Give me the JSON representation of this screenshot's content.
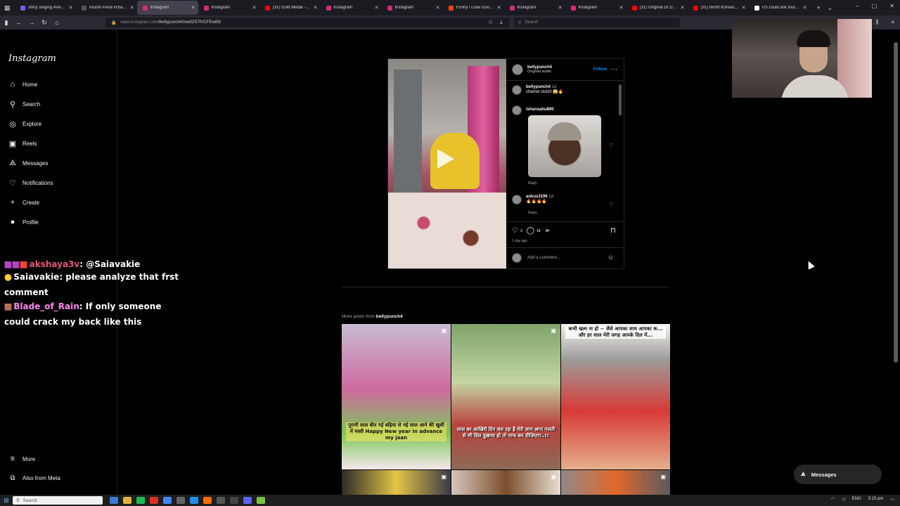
{
  "browser": {
    "tabs": [
      {
        "title": "Jinny singing AVAVA -",
        "color": "#7a5cff"
      },
      {
        "title": "#sushi #viral #challen",
        "color": "#555555"
      },
      {
        "title": "Instagram",
        "color": "#d62976",
        "active": true
      },
      {
        "title": "Instagram",
        "color": "#d62976"
      },
      {
        "title": "(31) Gold Medal - FS",
        "color": "#ff0000"
      },
      {
        "title": "Instagram",
        "color": "#d62976"
      },
      {
        "title": "Instagram",
        "color": "#d62976"
      },
      {
        "title": "Funny I Love Gooning",
        "color": "#ff4500"
      },
      {
        "title": "Instagram",
        "color": "#d62976"
      },
      {
        "title": "Instagram",
        "color": "#d62976"
      },
      {
        "title": "(31) Original Dr Donu",
        "color": "#ff0000"
      },
      {
        "title": "(31) North Koreans W",
        "color": "#ff0000"
      },
      {
        "title": "US could ask tourists",
        "color": "#ffffff"
      }
    ],
    "url_host": "www.instagram.com",
    "url_path": "/bellypunch4/reel/DS7fVCFEw83/",
    "search_placeholder": "Search"
  },
  "sidebar": {
    "logo": "Instagram",
    "items": [
      {
        "label": "Home",
        "icon": "⌂"
      },
      {
        "label": "Search",
        "icon": "⚲"
      },
      {
        "label": "Explore",
        "icon": "◎"
      },
      {
        "label": "Reels",
        "icon": "▣"
      },
      {
        "label": "Messages",
        "icon": "⟁"
      },
      {
        "label": "Notifications",
        "icon": "♡"
      },
      {
        "label": "Create",
        "icon": "+"
      },
      {
        "label": "Profile",
        "icon": "●"
      }
    ],
    "more": "More",
    "also_from_meta": "Also from Meta"
  },
  "chat": {
    "line0_user": "akshaya3v",
    "line0_text": ": @Saiavakie",
    "line1_user": "Saiavakie",
    "line1_text": ": please analyze that frst comment",
    "line2_user": "Blade_of_Rain",
    "line2_text": ": If only someone could crack my back like this"
  },
  "post": {
    "username": "bellypunch4",
    "audio": "Original audio",
    "follow": "Follow",
    "caption_user": "bellypunch4",
    "caption_time": "1d",
    "caption_text": "chamel clutch 😱🔥",
    "comment1_user": "ishansahu890",
    "reply1": "Reply",
    "comment2_user": "ankus3196",
    "comment2_time": "1d",
    "comment2_text": "🔥🔥🔥🔥",
    "reply2": "Reply",
    "likes": "3",
    "comments": "18",
    "ago": "1 day ago",
    "add_comment": "Add a comment…"
  },
  "more_posts": {
    "prefix": "More posts from",
    "user": "bellypunch4",
    "captions": [
      "पुरानी साल बीत गई बढ़िया से नई साल आने की खुशी में मस्ती Happy New year in advance my jaan",
      "साल का आखिरी दिन चल रहा है मेरी जान अगर गलती से भी दिल दुखाया हो तो माफ कर दीजिएगा..!!",
      "कभी खत्म ना हो ~ जैसे आपका साथ आपका क... और हर साल मेरी जगह आपके दिल में..."
    ]
  },
  "messages_pill": "Messages",
  "taskbar": {
    "search": "Search",
    "lang": "ENG",
    "time": "5:15 pm"
  }
}
